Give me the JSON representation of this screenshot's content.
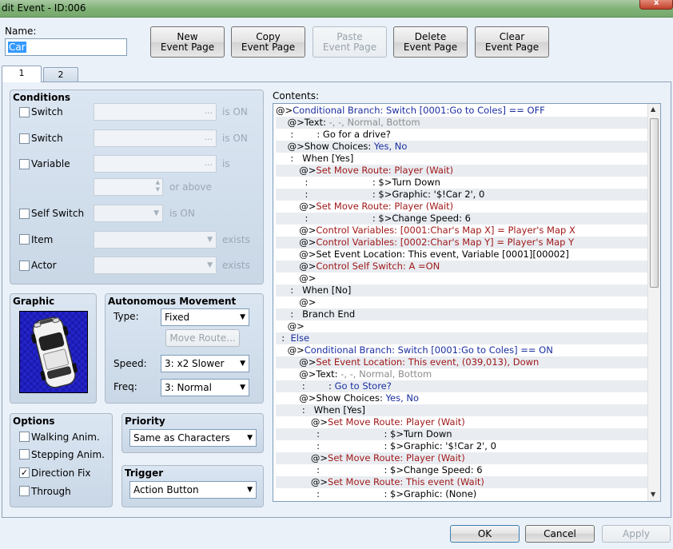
{
  "window": {
    "title": "dit Event - ID:006",
    "close_glyph": "x"
  },
  "name": {
    "label": "Name:",
    "value": "Car"
  },
  "toolbar": [
    {
      "line1": "New",
      "line2": "Event Page",
      "enabled": true
    },
    {
      "line1": "Copy",
      "line2": "Event Page",
      "enabled": true
    },
    {
      "line1": "Paste",
      "line2": "Event Page",
      "enabled": false
    },
    {
      "line1": "Delete",
      "line2": "Event Page",
      "enabled": true
    },
    {
      "line1": "Clear",
      "line2": "Event Page",
      "enabled": true
    }
  ],
  "tabs": [
    "1",
    "2"
  ],
  "conditions": {
    "title": "Conditions",
    "switch1": {
      "label": "Switch",
      "suffix": "is ON"
    },
    "switch2": {
      "label": "Switch",
      "suffix": "is ON"
    },
    "variable": {
      "label": "Variable",
      "suffix": "is",
      "or_above": "or above"
    },
    "self_switch": {
      "label": "Self Switch",
      "suffix": "is ON"
    },
    "item": {
      "label": "Item",
      "suffix": "exists"
    },
    "actor": {
      "label": "Actor",
      "suffix": "exists"
    },
    "ellipsis": "..."
  },
  "graphic": {
    "title": "Graphic"
  },
  "autonomous": {
    "title": "Autonomous Movement",
    "type_label": "Type:",
    "type_value": "Fixed",
    "move_route_button": "Move Route...",
    "speed_label": "Speed:",
    "speed_value": "3: x2 Slower",
    "freq_label": "Freq:",
    "freq_value": "3: Normal"
  },
  "options": {
    "title": "Options",
    "items": [
      {
        "label": "Walking Anim.",
        "checked": false
      },
      {
        "label": "Stepping Anim.",
        "checked": false
      },
      {
        "label": "Direction Fix",
        "checked": true
      },
      {
        "label": "Through",
        "checked": false
      }
    ],
    "check_glyph": "✓"
  },
  "priority": {
    "title": "Priority",
    "value": "Same as Characters"
  },
  "trigger": {
    "title": "Trigger",
    "value": "Action Button"
  },
  "contents": {
    "label": "Contents:",
    "lines": [
      [
        {
          "t": "@>",
          "c": ""
        },
        {
          "t": "Conditional Branch: Switch [0001:Go to Coles] == OFF",
          "c": "blu"
        }
      ],
      [
        {
          "t": "    @>Text: ",
          "c": ""
        },
        {
          "t": "-, -, Normal, Bottom",
          "c": "gr"
        }
      ],
      [
        {
          "t": "     :        : Go for a drive?",
          "c": ""
        }
      ],
      [
        {
          "t": "    @>Show Choices: ",
          "c": ""
        },
        {
          "t": "Yes, No",
          "c": "blu"
        }
      ],
      [
        {
          "t": "     :   When [Yes]",
          "c": ""
        }
      ],
      [
        {
          "t": "        @>",
          "c": ""
        },
        {
          "t": "Set Move Route: Player (Wait)",
          "c": "red"
        }
      ],
      [
        {
          "t": "          :                      : $>Turn Down",
          "c": ""
        }
      ],
      [
        {
          "t": "          :                      : $>Graphic: '$!Car 2', 0",
          "c": ""
        }
      ],
      [
        {
          "t": "        @>",
          "c": ""
        },
        {
          "t": "Set Move Route: Player (Wait)",
          "c": "red"
        }
      ],
      [
        {
          "t": "          :                      : $>Change Speed: 6",
          "c": ""
        }
      ],
      [
        {
          "t": "        @>",
          "c": ""
        },
        {
          "t": "Control Variables: [0001:Char's Map X] = Player's Map X",
          "c": "red"
        }
      ],
      [
        {
          "t": "        @>",
          "c": ""
        },
        {
          "t": "Control Variables: [0002:Char's Map Y] = Player's Map Y",
          "c": "red"
        }
      ],
      [
        {
          "t": "        @>Set Event Location: This event, Variable [0001][00002]",
          "c": ""
        }
      ],
      [
        {
          "t": "        @>",
          "c": ""
        },
        {
          "t": "Control Self Switch: A =ON",
          "c": "red"
        }
      ],
      [
        {
          "t": "        @>",
          "c": ""
        }
      ],
      [
        {
          "t": "     :   When [No]",
          "c": ""
        }
      ],
      [
        {
          "t": "        @>",
          "c": ""
        }
      ],
      [
        {
          "t": "     :   Branch End",
          "c": ""
        }
      ],
      [
        {
          "t": "    @>",
          "c": ""
        }
      ],
      [
        {
          "t": "  :  ",
          "c": ""
        },
        {
          "t": "Else",
          "c": "blu"
        }
      ],
      [
        {
          "t": "    @>",
          "c": ""
        },
        {
          "t": "Conditional Branch: Switch [0001:Go to Coles] == ON",
          "c": "blu"
        }
      ],
      [
        {
          "t": "        @>",
          "c": ""
        },
        {
          "t": "Set Event Location: This event, (039,013), Down",
          "c": "red"
        }
      ],
      [
        {
          "t": "        @>Text: ",
          "c": ""
        },
        {
          "t": "-, -, Normal, Bottom",
          "c": "gr"
        }
      ],
      [
        {
          "t": "         :        : ",
          "c": ""
        },
        {
          "t": "Go to Store?",
          "c": "blu"
        }
      ],
      [
        {
          "t": "        @>Show Choices: ",
          "c": ""
        },
        {
          "t": "Yes, No",
          "c": "blu"
        }
      ],
      [
        {
          "t": "         :   When [Yes]",
          "c": ""
        }
      ],
      [
        {
          "t": "            @>",
          "c": ""
        },
        {
          "t": "Set Move Route: Player (Wait)",
          "c": "red"
        }
      ],
      [
        {
          "t": "              :                      : $>Turn Down",
          "c": ""
        }
      ],
      [
        {
          "t": "              :                      : $>Graphic: '$!Car 2', 0",
          "c": ""
        }
      ],
      [
        {
          "t": "            @>",
          "c": ""
        },
        {
          "t": "Set Move Route: Player (Wait)",
          "c": "red"
        }
      ],
      [
        {
          "t": "              :                      : $>Change Speed: 6",
          "c": ""
        }
      ],
      [
        {
          "t": "            @>",
          "c": ""
        },
        {
          "t": "Set Move Route: This event (Wait)",
          "c": "red"
        }
      ],
      [
        {
          "t": "              :                      : $>Graphic: (None)",
          "c": ""
        }
      ]
    ]
  },
  "footer": {
    "ok": "OK",
    "cancel": "Cancel",
    "apply": "Apply"
  }
}
